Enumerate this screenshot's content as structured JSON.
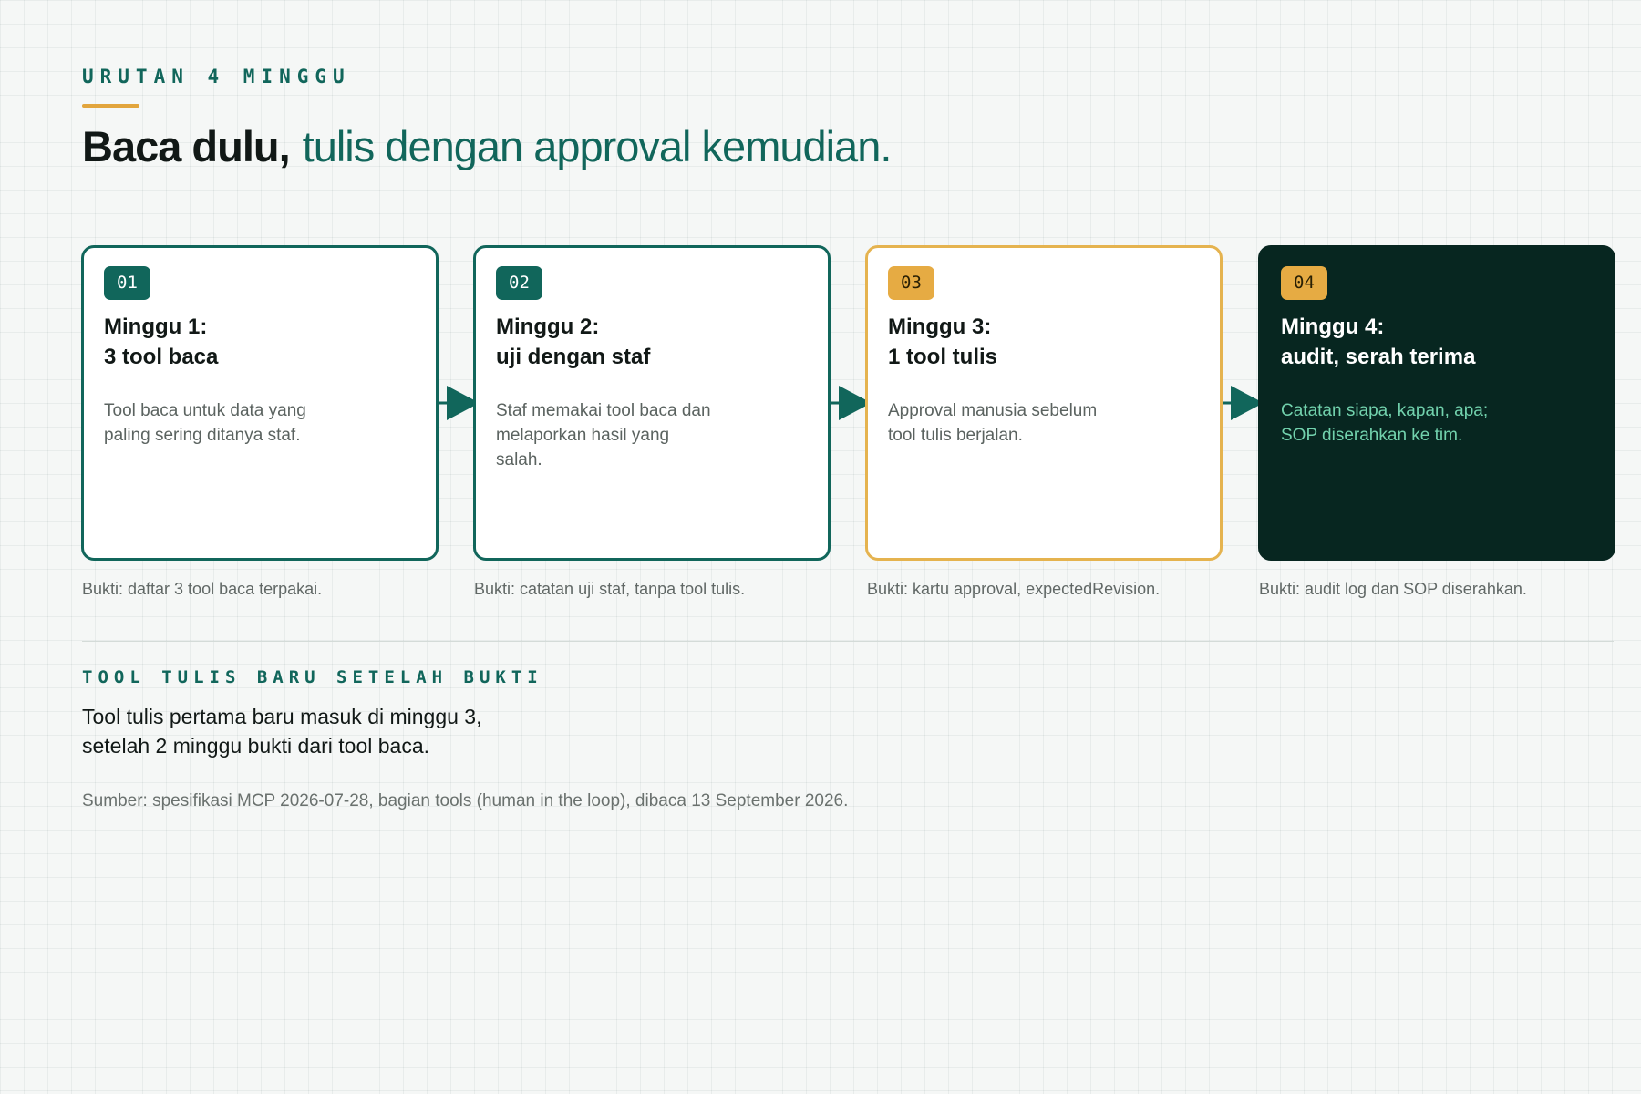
{
  "header": {
    "eyebrow": "URUTAN 4 MINGGU",
    "headline_strong": "Baca dulu,",
    "headline_accent": "tulis dengan approval kemudian."
  },
  "steps": [
    {
      "number": "01",
      "title_line1": "Minggu 1:",
      "title_line2": "3 tool baca",
      "description": "Tool baca untuk data yang paling sering ditanya staf.",
      "proof": "Bukti: daftar 3 tool baca terpakai."
    },
    {
      "number": "02",
      "title_line1": "Minggu 2:",
      "title_line2": "uji dengan staf",
      "description": "Staf memakai tool baca dan melaporkan hasil yang salah.",
      "proof": "Bukti: catatan uji staf, tanpa tool tulis."
    },
    {
      "number": "03",
      "title_line1": "Minggu 3:",
      "title_line2": "1 tool tulis",
      "description": "Approval manusia sebelum tool tulis berjalan.",
      "proof": "Bukti: kartu approval, expectedRevision."
    },
    {
      "number": "04",
      "title_line1": "Minggu 4:",
      "title_line2": "audit, serah terima",
      "description": "Catatan siapa, kapan, apa; SOP diserahkan ke tim.",
      "proof": "Bukti: audit log dan SOP diserahkan."
    }
  ],
  "footer": {
    "eyebrow": "TOOL TULIS BARU SETELAH BUKTI",
    "statement_line1": "Tool tulis pertama baru masuk di minggu 3,",
    "statement_line2": "setelah 2 minggu bukti dari tool baca.",
    "source": "Sumber: spesifikasi MCP 2026-07-28, bagian tools (human in the loop), dibaca 13 September 2026."
  },
  "colors": {
    "accent_teal": "#11665b",
    "accent_amber": "#e6ab43",
    "dark_card": "#072620"
  }
}
